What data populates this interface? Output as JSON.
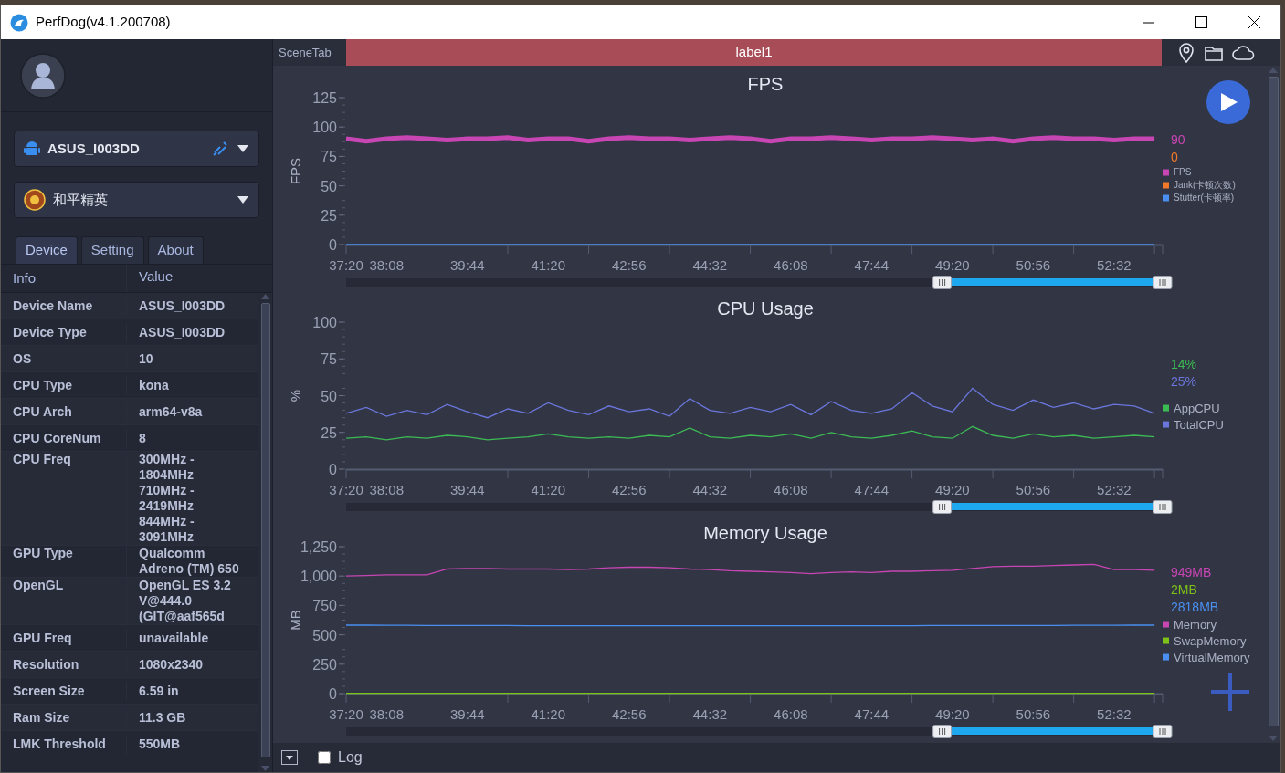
{
  "window": {
    "title": "PerfDog(v4.1.200708)"
  },
  "sidebar": {
    "device": {
      "name": "ASUS_I003DD"
    },
    "app": {
      "name": "和平精英"
    },
    "tabs": [
      {
        "label": "Device",
        "selected": true
      },
      {
        "label": "Setting",
        "selected": false
      },
      {
        "label": "About",
        "selected": false
      }
    ],
    "table": {
      "columns": [
        "Info",
        "Value"
      ],
      "rows": [
        {
          "info": "Device Name",
          "value": "ASUS_I003DD"
        },
        {
          "info": "Device Type",
          "value": "ASUS_I003DD"
        },
        {
          "info": "OS",
          "value": "10"
        },
        {
          "info": "CPU Type",
          "value": "kona"
        },
        {
          "info": "CPU Arch",
          "value": "arm64-v8a"
        },
        {
          "info": "CPU CoreNum",
          "value": "8"
        },
        {
          "info": "CPU Freq",
          "value": "300MHz -\n1804MHz\n710MHz -\n2419MHz\n844MHz -\n3091MHz"
        },
        {
          "info": "GPU Type",
          "value": "Qualcomm\nAdreno (TM) 650"
        },
        {
          "info": "OpenGL",
          "value": "OpenGL ES 3.2\nV@444.0\n(GIT@aaf565d"
        },
        {
          "info": "GPU Freq",
          "value": "unavailable"
        },
        {
          "info": "Resolution",
          "value": "1080x2340"
        },
        {
          "info": "Screen Size",
          "value": "6.59 in"
        },
        {
          "info": "Ram Size",
          "value": "11.3 GB"
        },
        {
          "info": "LMK Threshold",
          "value": "550MB"
        }
      ]
    }
  },
  "scene_tab": {
    "label": "SceneTab",
    "active_label": "label1"
  },
  "charts": [
    {
      "readouts": [
        {
          "text": "90",
          "color": "#c845b4"
        },
        {
          "text": "0",
          "color": "#f07828"
        }
      ],
      "slider": {
        "level": 0.27
      },
      "chart_data": {
        "type": "line",
        "legend": "right",
        "title": "FPS",
        "ylabel": "FPS",
        "ylim": [
          0,
          125
        ],
        "yticks": [
          0,
          25,
          50,
          75,
          100,
          125
        ],
        "categories": [
          "37:20",
          null,
          "38:08",
          null,
          null,
          null,
          "39:44",
          null,
          null,
          null,
          "41:20",
          null,
          null,
          null,
          "42:56",
          null,
          null,
          null,
          "44:32",
          null,
          null,
          null,
          "46:08",
          null,
          null,
          null,
          "47:44",
          null,
          null,
          null,
          "49:20",
          null,
          null,
          null,
          "50:56",
          null,
          null,
          null,
          "52:32",
          null,
          null
        ],
        "series": [
          {
            "name": "FPS",
            "color": "#c845b4",
            "values": [
              90,
              88,
              90,
              91,
              90,
              89,
              90,
              90,
              91,
              89,
              90,
              90,
              88,
              90,
              91,
              90,
              90,
              89,
              90,
              91,
              90,
              88,
              90,
              90,
              91,
              90,
              89,
              90,
              90,
              91,
              90,
              89,
              90,
              88,
              90,
              91,
              90,
              90,
              89,
              90,
              90
            ]
          },
          {
            "name": "Jank(卡顿次数)",
            "color": "#f07828",
            "values": [
              null,
              null,
              null,
              null,
              null,
              null,
              null,
              null,
              null,
              null,
              null,
              null,
              null,
              null,
              null,
              null,
              null,
              null,
              null,
              null,
              null,
              null,
              null,
              null,
              null,
              null,
              null,
              null,
              null,
              null,
              null,
              null,
              null,
              null,
              null,
              null,
              null,
              null,
              null,
              null,
              null
            ]
          },
          {
            "name": "Stutter(卡顿率)",
            "color": "#4a8ff0",
            "values": [
              0,
              0,
              0,
              0,
              0,
              0,
              0,
              0,
              0,
              0,
              0,
              0,
              0,
              0,
              0,
              0,
              0,
              0,
              0,
              0,
              0,
              0,
              0,
              0,
              0,
              0,
              0,
              0,
              0,
              0,
              0,
              0,
              0,
              0,
              0,
              0,
              0,
              0,
              0,
              0,
              0
            ]
          }
        ]
      }
    },
    {
      "readouts": [
        {
          "text": "14%",
          "color": "#3cba54"
        },
        {
          "text": "25%",
          "color": "#6a76dc"
        }
      ],
      "slider": {
        "level": 0.27
      },
      "chart_data": {
        "type": "line",
        "legend": "right",
        "title": "CPU Usage",
        "ylabel": "%",
        "ylim": [
          0,
          100
        ],
        "yticks": [
          0,
          25,
          50,
          75,
          100
        ],
        "categories": [
          "37:20",
          null,
          "38:08",
          null,
          null,
          null,
          "39:44",
          null,
          null,
          null,
          "41:20",
          null,
          null,
          null,
          "42:56",
          null,
          null,
          null,
          "44:32",
          null,
          null,
          null,
          "46:08",
          null,
          null,
          null,
          "47:44",
          null,
          null,
          null,
          "49:20",
          null,
          null,
          null,
          "50:56",
          null,
          null,
          null,
          "52:32",
          null,
          null
        ],
        "series": [
          {
            "name": "AppCPU",
            "color": "#3cba54",
            "values": [
              21,
              22,
              20,
              22,
              21,
              23,
              22,
              20,
              21,
              22,
              24,
              22,
              21,
              22,
              21,
              23,
              22,
              28,
              22,
              21,
              23,
              22,
              24,
              21,
              25,
              22,
              21,
              23,
              26,
              22,
              21,
              29,
              23,
              21,
              24,
              22,
              23,
              21,
              22,
              23,
              22
            ]
          },
          {
            "name": "TotalCPU",
            "color": "#6a76dc",
            "values": [
              38,
              42,
              36,
              40,
              37,
              44,
              39,
              35,
              41,
              38,
              45,
              40,
              37,
              43,
              39,
              41,
              36,
              48,
              40,
              38,
              42,
              39,
              44,
              37,
              46,
              40,
              38,
              41,
              52,
              43,
              39,
              55,
              44,
              40,
              47,
              42,
              45,
              41,
              44,
              43,
              38
            ]
          }
        ]
      }
    },
    {
      "readouts": [
        {
          "text": "949MB",
          "color": "#c845b4"
        },
        {
          "text": "2MB",
          "color": "#7cc218"
        },
        {
          "text": "2818MB",
          "color": "#4a8ff0"
        }
      ],
      "slider": {
        "level": 0.27
      },
      "chart_data": {
        "type": "line",
        "legend": "right",
        "title": "Memory Usage",
        "ylabel": "MB",
        "ylim": [
          0,
          1250
        ],
        "yticks": [
          {
            "value": 0,
            "label": "0"
          },
          {
            "value": 250,
            "label": "250"
          },
          {
            "value": 500,
            "label": "500"
          },
          {
            "value": 750,
            "label": "750"
          },
          {
            "value": 1000,
            "label": "1,000"
          },
          {
            "value": 1250,
            "label": "1,250"
          }
        ],
        "categories": [
          "37:20",
          null,
          "38:08",
          null,
          null,
          null,
          "39:44",
          null,
          null,
          null,
          "41:20",
          null,
          null,
          null,
          "42:56",
          null,
          null,
          null,
          "44:32",
          null,
          null,
          null,
          "46:08",
          null,
          null,
          null,
          "47:44",
          null,
          null,
          null,
          "49:20",
          null,
          null,
          null,
          "50:56",
          null,
          null,
          null,
          "52:32",
          null,
          null
        ],
        "series": [
          {
            "name": "Memory",
            "color": "#c845b4",
            "values": [
              1000,
              1005,
              1010,
              1010,
              1010,
              1060,
              1065,
              1065,
              1060,
              1060,
              1060,
              1055,
              1060,
              1070,
              1075,
              1075,
              1070,
              1060,
              1055,
              1045,
              1040,
              1035,
              1030,
              1020,
              1030,
              1035,
              1030,
              1040,
              1040,
              1045,
              1050,
              1065,
              1080,
              1085,
              1085,
              1090,
              1095,
              1100,
              1055,
              1055,
              1050
            ]
          },
          {
            "name": "SwapMemory",
            "color": "#7cc218",
            "values": [
              2,
              2,
              2,
              2,
              2,
              2,
              2,
              2,
              2,
              2,
              2,
              2,
              2,
              2,
              2,
              2,
              2,
              2,
              2,
              2,
              2,
              2,
              2,
              2,
              2,
              2,
              2,
              2,
              2,
              2,
              2,
              2,
              2,
              2,
              2,
              2,
              2,
              2,
              2,
              2,
              2
            ]
          },
          {
            "name": "VirtualMemory",
            "color": "#4a8ff0",
            "values": [
              582,
              582,
              581,
              581,
              580,
              580,
              580,
              579,
              579,
              578,
              578,
              578,
              578,
              577,
              577,
              577,
              577,
              578,
              578,
              578,
              578,
              577,
              577,
              577,
              577,
              578,
              578,
              578,
              578,
              579,
              579,
              579,
              580,
              580,
              580,
              580,
              581,
              581,
              581,
              582,
              582
            ]
          }
        ]
      }
    }
  ],
  "bottom_bar": {
    "log": {
      "label": "Log",
      "checked": false
    }
  }
}
